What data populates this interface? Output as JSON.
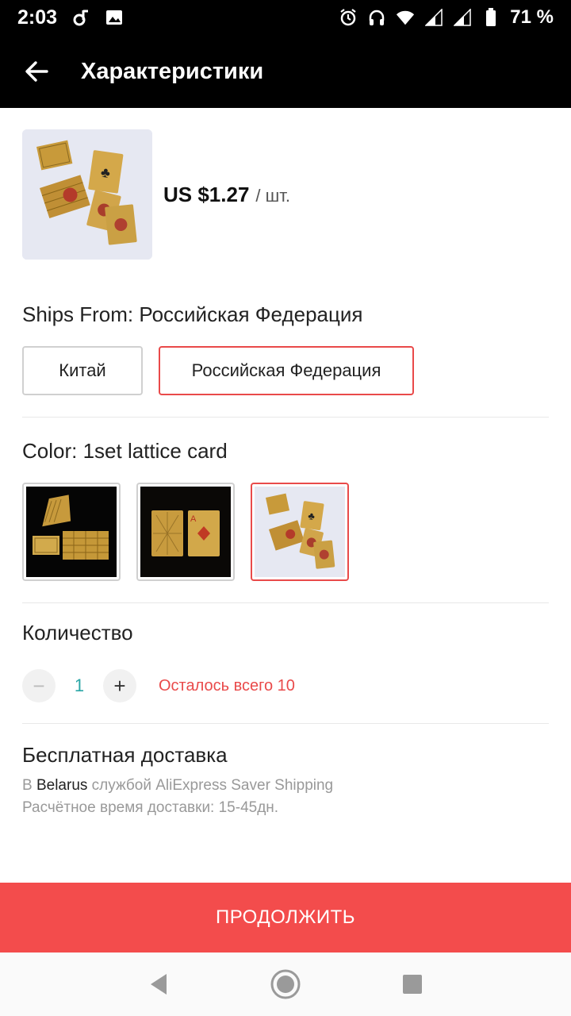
{
  "status_bar": {
    "time": "2:03",
    "battery": "71 %"
  },
  "header": {
    "title": "Характеристики"
  },
  "product": {
    "price": "US $1.27",
    "unit": "/ шт."
  },
  "ships_from": {
    "label": "Ships From: Российская Федерация",
    "options": [
      "Китай",
      "Российская Федерация"
    ],
    "selected": "Российская Федерация"
  },
  "color": {
    "label": "Color: 1set lattice card",
    "selected_index": 2
  },
  "quantity": {
    "label": "Количество",
    "minus": "−",
    "value": "1",
    "plus": "+",
    "stock_note": "Осталось всего 10"
  },
  "shipping": {
    "title": "Бесплатная доставка",
    "prefix": "В",
    "destination": "Belarus",
    "suffix": "службой AliExpress Saver Shipping",
    "eta": "Расчётное время доставки: 15-45дн."
  },
  "footer": {
    "continue_label": "ПРОДОЛЖИТЬ"
  },
  "colors": {
    "accent": "#f34c4c",
    "qty_value": "#2aa6a6",
    "app_bar": "#000000"
  },
  "icons": [
    "back-arrow-icon",
    "music-icon",
    "image-icon",
    "alarm-icon",
    "headphones-icon",
    "wifi-icon",
    "signal-icon",
    "battery-icon",
    "nav-back-icon",
    "nav-home-icon",
    "nav-recents-icon"
  ]
}
